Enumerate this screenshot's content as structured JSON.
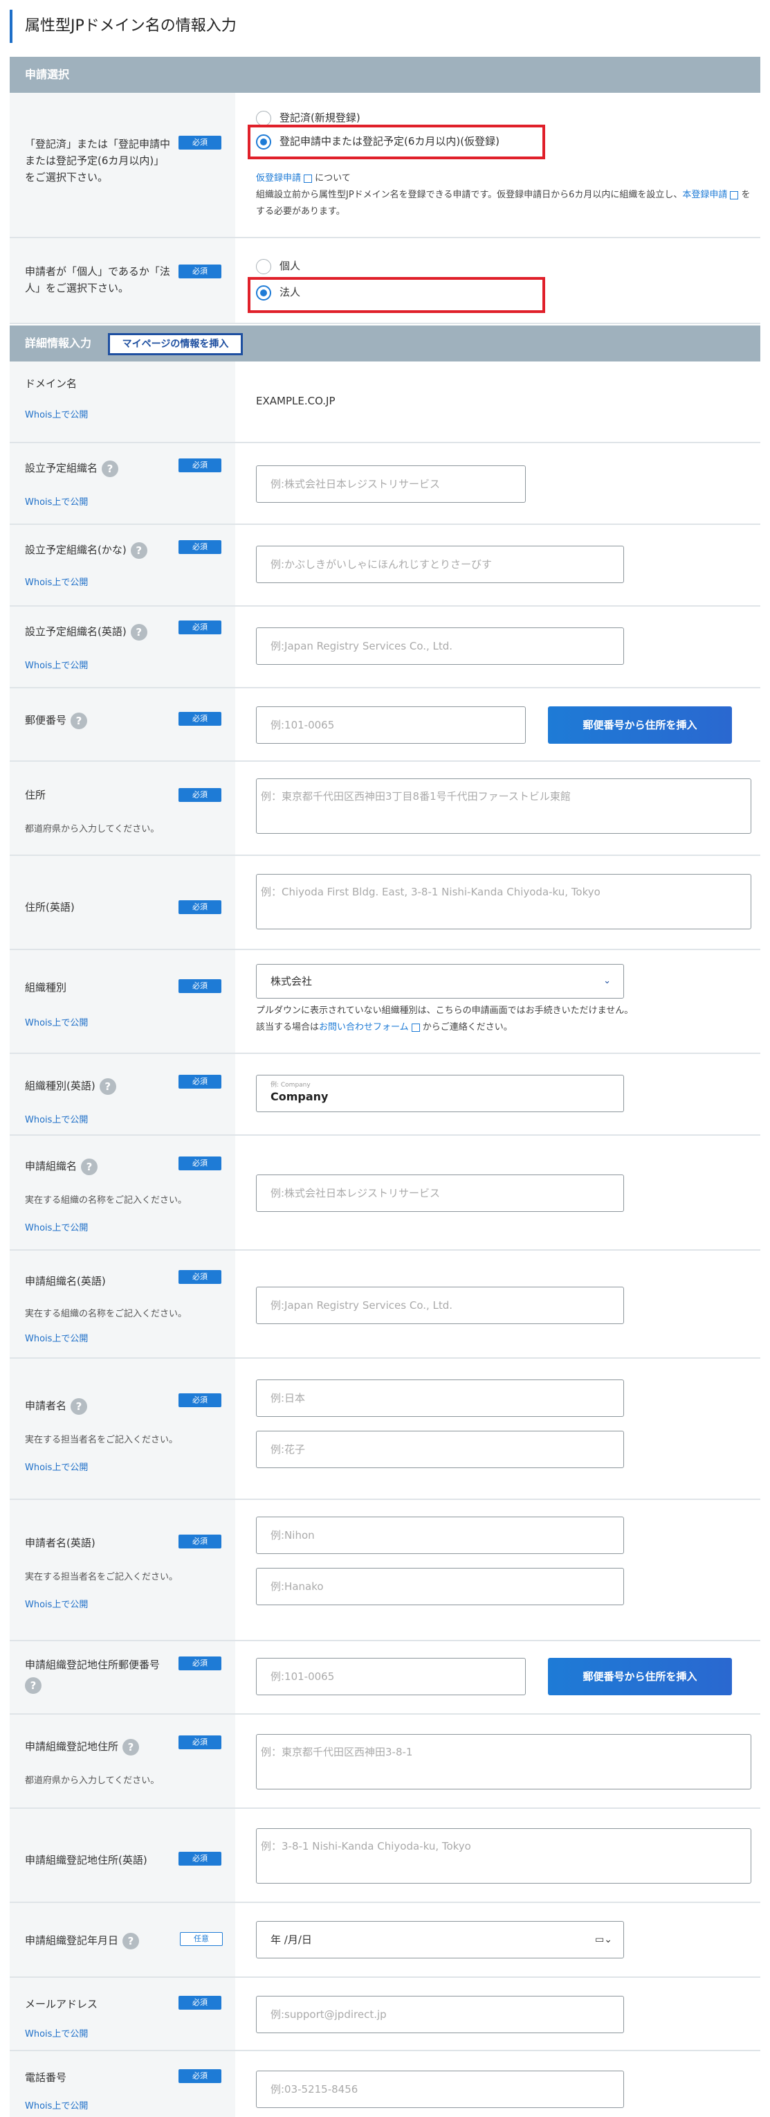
{
  "page_title": "属性型JPドメイン名の情報入力",
  "sections": {
    "apply_select": "申請選択",
    "detail": "詳細情報入力",
    "detail_button": "マイページの情報を挿入"
  },
  "badges": {
    "required": "必須",
    "optional": "任意"
  },
  "whois": "Whois上で公開",
  "help_icon": "?",
  "apply_type": {
    "label": "「登記済」または「登記申請中または登記予定(6カ月以内)」をご選択下さい。",
    "options": [
      "登記済(新規登録)",
      "登記申請中または登記予定(6カ月以内)(仮登録)"
    ],
    "selected_index": 1,
    "note_link": "仮登録申請",
    "note_suffix": "について",
    "note_text": "組織設立前から属性型JPドメイン名を登録できる申請です。仮登録申請日から6カ月以内に組織を設立し、",
    "note_link2": "本登録申請",
    "note_tail": "をする必要があります。"
  },
  "applicant_type": {
    "label": "申請者が「個人」であるか「法人」をご選択下さい。",
    "options": [
      "個人",
      "法人"
    ],
    "selected_index": 1
  },
  "domain": {
    "label": "ドメイン名",
    "value": "EXAMPLE.CO.JP"
  },
  "org_name": {
    "label": "設立予定組織名",
    "placeholder": "例:株式会社日本レジストリサービス"
  },
  "org_name_kana": {
    "label": "設立予定組織名(かな)",
    "placeholder": "例:かぶしきがいしゃにほんれじすとりさーびす"
  },
  "org_name_en": {
    "label": "設立予定組織名(英語)",
    "placeholder": "例:Japan Registry Services Co., Ltd."
  },
  "zip": {
    "label": "郵便番号",
    "placeholder": "例:101-0065",
    "button": "郵便番号から住所を挿入"
  },
  "address": {
    "label": "住所",
    "sub": "都道府県から入力してください。",
    "placeholder": "例：東京都千代田区西神田3丁目8番1号千代田ファーストビル東館"
  },
  "address_en": {
    "label": "住所(英語)",
    "placeholder": "例：Chiyoda First Bldg. East, 3-8-1 Nishi-Kanda Chiyoda-ku, Tokyo"
  },
  "org_type": {
    "label": "組織種別",
    "value": "株式会社",
    "note1": "プルダウンに表示されていない組織種別は、こちらの申請画面ではお手続きいただけません。",
    "note2_pre": "該当する場合は",
    "note2_link": "お問い合わせフォーム",
    "note2_post": "からご連絡ください。"
  },
  "org_type_en": {
    "label": "組織種別(英語)",
    "small": "例: Company",
    "value": "Company"
  },
  "applicant_org": {
    "label": "申請組織名",
    "sub": "実在する組織の名称をご記入ください。",
    "placeholder": "例:株式会社日本レジストリサービス"
  },
  "applicant_org_en": {
    "label": "申請組織名(英語)",
    "sub": "実在する組織の名称をご記入ください。",
    "placeholder": "例:Japan Registry Services Co., Ltd."
  },
  "applicant_name": {
    "label": "申請者名",
    "sub": "実在する担当者名をご記入ください。",
    "placeholder_last": "例:日本",
    "placeholder_first": "例:花子"
  },
  "applicant_name_en": {
    "label": "申請者名(英語)",
    "sub": "実在する担当者名をご記入ください。",
    "placeholder_last": "例:Nihon",
    "placeholder_first": "例:Hanako"
  },
  "reg_zip": {
    "label": "申請組織登記地住所郵便番号",
    "placeholder": "例:101-0065",
    "button": "郵便番号から住所を挿入"
  },
  "reg_address": {
    "label": "申請組織登記地住所",
    "sub": "都道府県から入力してください。",
    "placeholder": "例：東京都千代田区西神田3-8-1"
  },
  "reg_address_en": {
    "label": "申請組織登記地住所(英語)",
    "placeholder": "例：3-8-1 Nishi-Kanda Chiyoda-ku, Tokyo"
  },
  "reg_date": {
    "label": "申請組織登記年月日",
    "placeholder": "年 /月/日"
  },
  "email": {
    "label": "メールアドレス",
    "placeholder": "例:support@jpdirect.jp"
  },
  "phone": {
    "label": "電話番号",
    "placeholder": "例:03-5215-8456"
  }
}
